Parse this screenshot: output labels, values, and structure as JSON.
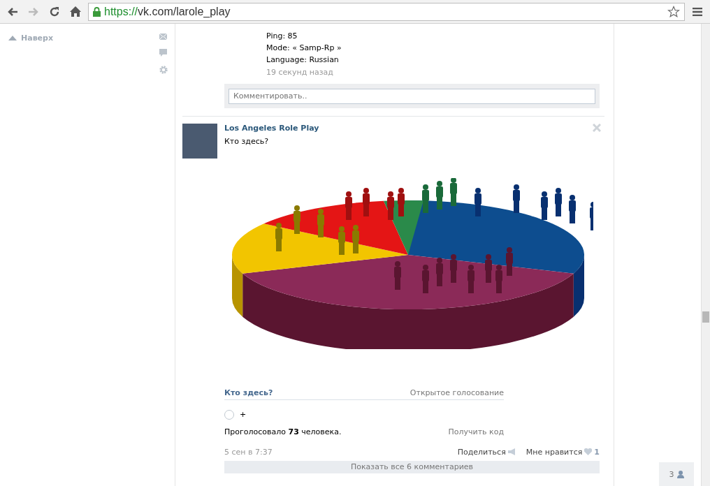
{
  "browser": {
    "scheme": "https://",
    "address": "vk.com/larole_play"
  },
  "sidebar": {
    "back_to_top": "Наверх"
  },
  "previous_post": {
    "lines": [
      "Ping: 85",
      "Mode: « Samp-Rp »",
      "Language: Russian"
    ],
    "time": "19 секунд назад",
    "comment": {
      "placeholder": "Комментировать.."
    }
  },
  "post": {
    "author": "Los Angeles Role Play",
    "text": "Кто здесь?",
    "poll": {
      "title": "Кто здесь?",
      "type": "Открытое голосование",
      "options": [
        {
          "label": "+",
          "selected": false
        }
      ],
      "votes": "Проголосовало **73** человека.",
      "get_code": "Получить код"
    },
    "date": "5 сен в 7:37",
    "share": "Поделиться",
    "like": "Мне нравится",
    "like_count": "1",
    "show_comments": "Показать все 6 комментариев"
  },
  "friends_online": "3"
}
